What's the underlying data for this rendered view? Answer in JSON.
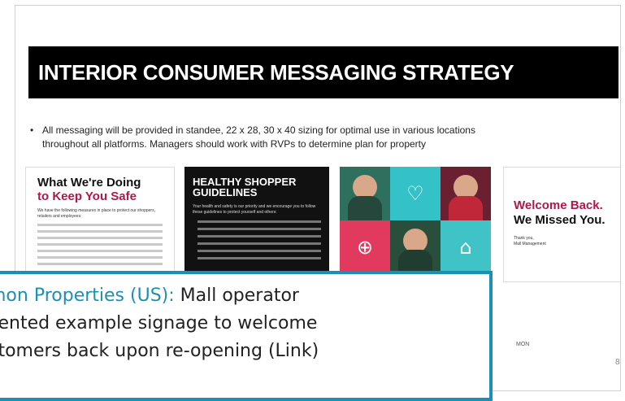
{
  "slide": {
    "title": "INTERIOR CONSUMER MESSAGING STRATEGY",
    "bullet_marker": "•",
    "bullet_line1": "All messaging will be provided in standee, 22 x 28, 30 x  40 sizing for optimal use in various locations",
    "bullet_line2": "throughout all platforms. Managers should work with RVPs to determine plan for property",
    "page_number": "8",
    "logo_text": "MON"
  },
  "panels": {
    "keep_safe": {
      "heading_line1": "What We're Doing",
      "heading_line2": "to Keep You Safe",
      "intro": "We have the following measures in place to protect our shoppers, retailers and employees:"
    },
    "guidelines": {
      "heading_line1": "HEALTHY SHOPPER",
      "heading_line2": "GUIDELINES",
      "intro": "Your health and safety is our priority and we encourage you to follow these guidelines to protect yourself and others:"
    },
    "welcome": {
      "line1": "Welcome Back.",
      "line2": "We Missed You.",
      "signoff_line1": "Thank you,",
      "signoff_line2": "Mall Management"
    }
  },
  "icons": {
    "heart": "♡",
    "first_aid": "⊕",
    "basket": "⌂"
  },
  "colors": {
    "accent_magenta": "#b0174a",
    "caption_blue": "#1b8fb5",
    "title_bar": "#000000"
  },
  "caption": {
    "org": "mon Properties (US):",
    "line1_rest": " Mall operator",
    "line2": "sented example signage to welcome",
    "line3": "stomers back upon re-opening (Link)"
  }
}
